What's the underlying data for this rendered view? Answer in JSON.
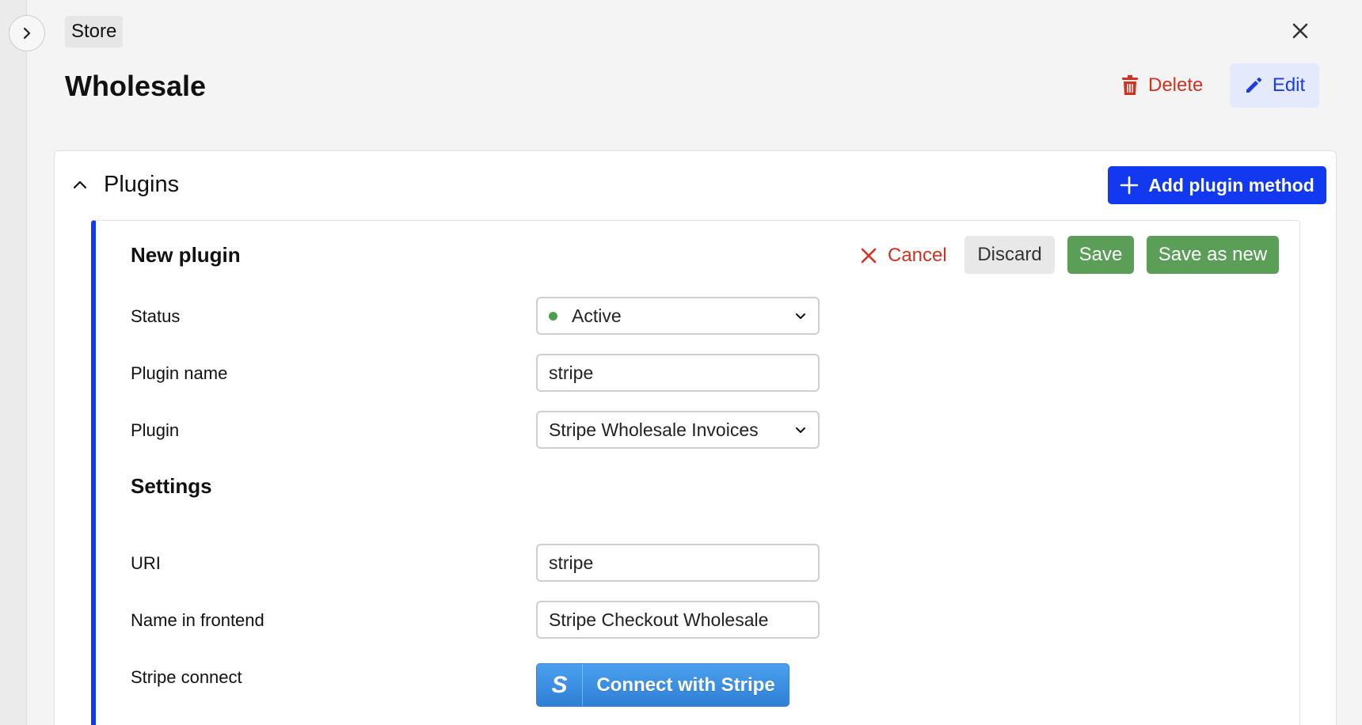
{
  "breadcrumb": {
    "label": "Store"
  },
  "header": {
    "title": "Wholesale",
    "delete_label": "Delete",
    "edit_label": "Edit"
  },
  "plugins_section": {
    "title": "Plugins",
    "add_label": "Add plugin method"
  },
  "plugin_form": {
    "title": "New plugin",
    "cancel_label": "Cancel",
    "discard_label": "Discard",
    "save_label": "Save",
    "save_new_label": "Save as new",
    "status": {
      "label": "Status",
      "value": "Active"
    },
    "plugin_name": {
      "label": "Plugin name",
      "value": "stripe"
    },
    "plugin": {
      "label": "Plugin",
      "value": "Stripe Wholesale Invoices"
    },
    "settings_heading": "Settings",
    "uri": {
      "label": "URI",
      "value": "stripe"
    },
    "frontend_name": {
      "label": "Name in frontend",
      "value": "Stripe Checkout Wholesale"
    },
    "stripe_connect": {
      "label": "Stripe connect",
      "button_label": "Connect with Stripe",
      "logo_letter": "S"
    }
  },
  "colors": {
    "accent_blue": "#1238f0",
    "danger_red": "#d3311f",
    "save_green": "#5b9e57",
    "status_active": "#4aa04a",
    "stripe_blue": "#2f7fd6"
  },
  "icons": [
    "chevron-right-icon",
    "close-icon",
    "trash-icon",
    "pencil-icon",
    "chevron-up-icon",
    "plus-icon",
    "x-icon",
    "chevron-down-icon",
    "stripe-logo-icon"
  ]
}
